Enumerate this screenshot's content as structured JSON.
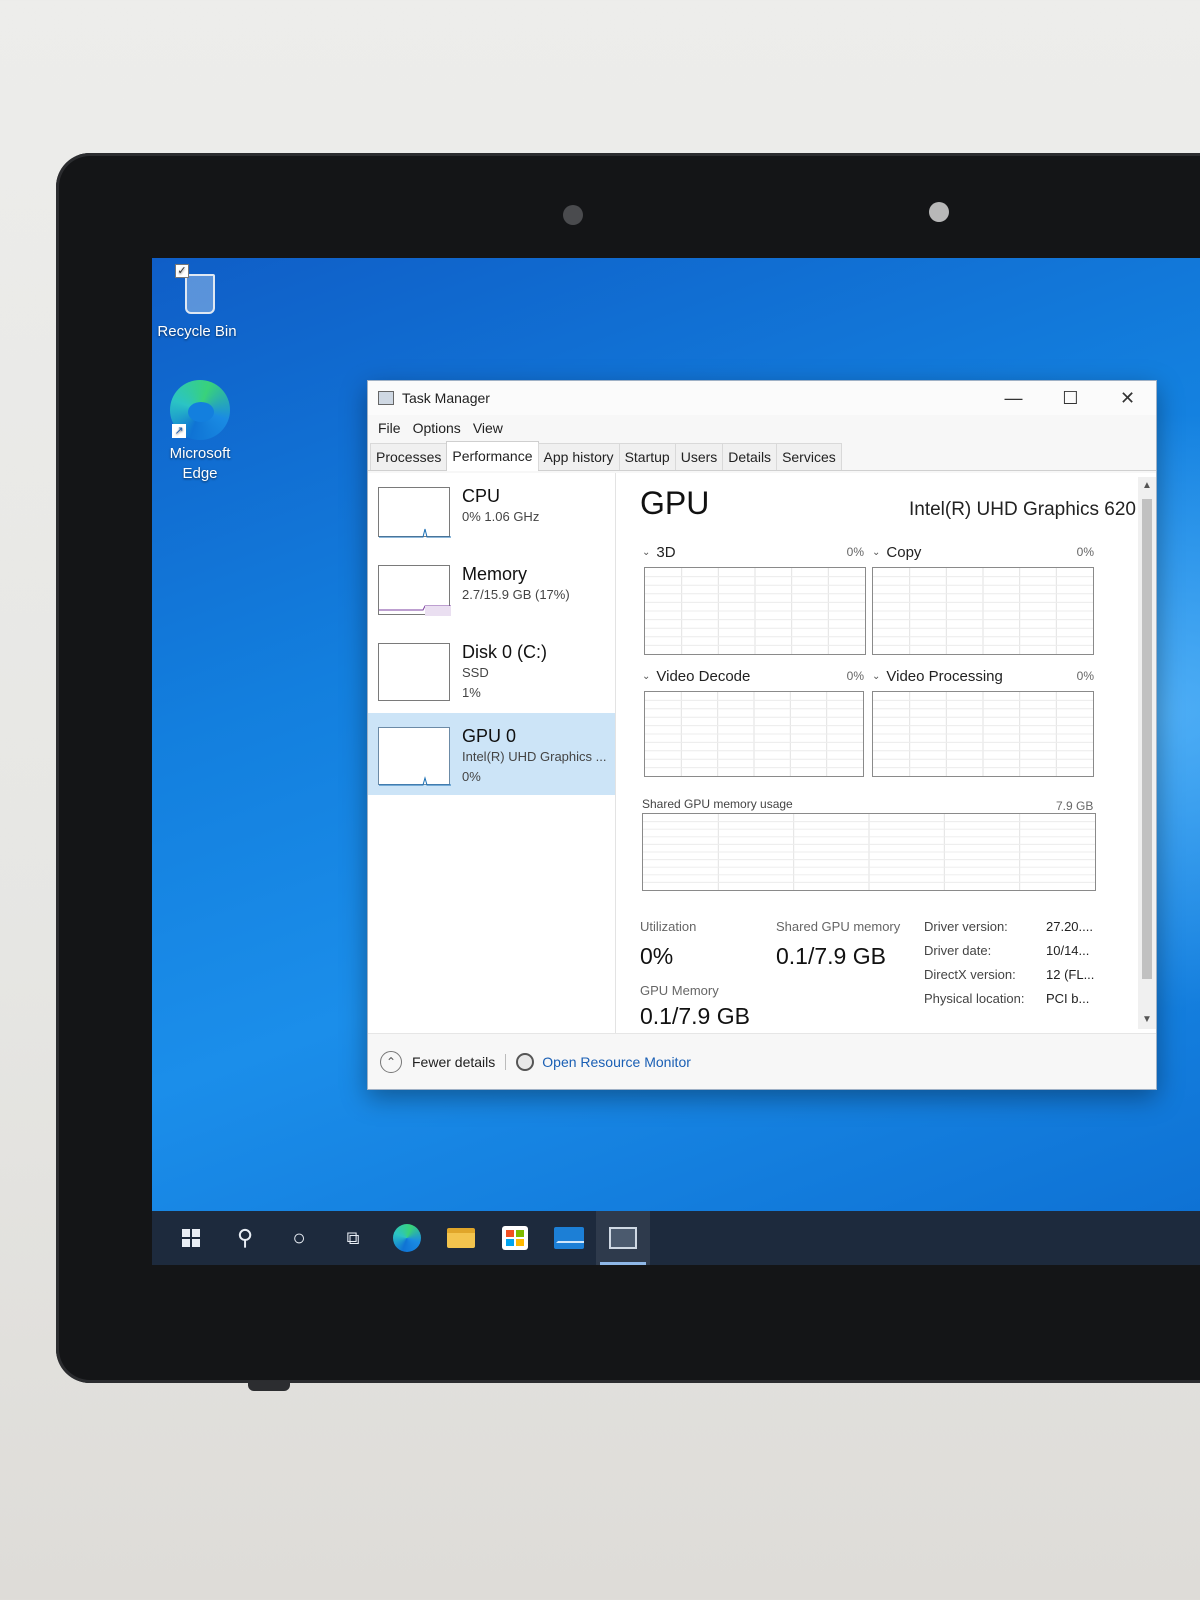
{
  "desktop": {
    "icons": [
      {
        "label": "Recycle Bin",
        "icon": "recycle-bin-icon"
      },
      {
        "label": "Microsoft Edge",
        "icon": "edge-icon"
      }
    ]
  },
  "taskbar": {
    "items": [
      "start-icon",
      "search-icon",
      "cortana-icon",
      "task-view-icon",
      "edge-icon",
      "file-explorer-icon",
      "store-icon",
      "mail-icon",
      "task-manager-icon"
    ],
    "active": "task-manager-icon"
  },
  "window": {
    "title": "Task Manager",
    "controls": {
      "minimize": "—",
      "maximize": "☐",
      "close": "✕"
    }
  },
  "menu": [
    "File",
    "Options",
    "View"
  ],
  "tabs": [
    "Processes",
    "Performance",
    "App history",
    "Startup",
    "Users",
    "Details",
    "Services"
  ],
  "active_tab": "Performance",
  "sidebar": [
    {
      "title": "CPU",
      "sub1": "0%  1.06 GHz",
      "sub2": ""
    },
    {
      "title": "Memory",
      "sub1": "2.7/15.9 GB (17%)",
      "sub2": ""
    },
    {
      "title": "Disk 0 (C:)",
      "sub1": "SSD",
      "sub2": "1%"
    },
    {
      "title": "GPU 0",
      "sub1": "Intel(R) UHD Graphics ...",
      "sub2": "0%"
    }
  ],
  "selected_sidebar": "GPU 0",
  "main": {
    "title": "GPU",
    "adapter": "Intel(R) UHD Graphics 620",
    "engines": [
      {
        "name": "3D",
        "value": "0%"
      },
      {
        "name": "Copy",
        "value": "0%"
      },
      {
        "name": "Video Decode",
        "value": "0%"
      },
      {
        "name": "Video Processing",
        "value": "0%"
      }
    ],
    "shared_label": "Shared GPU memory usage",
    "shared_max": "7.9 GB",
    "stats": {
      "utilization_label": "Utilization",
      "utilization_value": "0%",
      "shared_label": "Shared GPU memory",
      "shared_value": "0.1/7.9 GB",
      "gpu_memory_label": "GPU Memory",
      "gpu_memory_value": "0.1/7.9 GB"
    },
    "properties": [
      {
        "k": "Driver version:",
        "v": "27.20...."
      },
      {
        "k": "Driver date:",
        "v": "10/14..."
      },
      {
        "k": "DirectX version:",
        "v": "12 (FL..."
      },
      {
        "k": "Physical location:",
        "v": "PCI b..."
      }
    ]
  },
  "footer": {
    "fewer_details": "Fewer details",
    "open_resource_monitor": "Open Resource Monitor"
  },
  "colors": {
    "selection": "#cce4f7",
    "link": "#1a5fb4",
    "wallpaper": "#137fde",
    "taskbar": "#1d2a3d"
  }
}
